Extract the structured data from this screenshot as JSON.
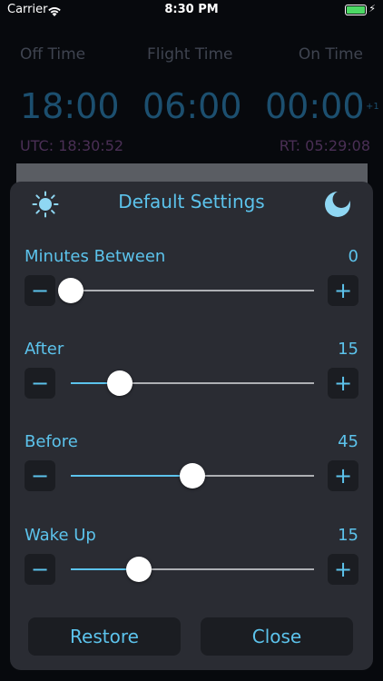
{
  "status_bar": {
    "carrier": "Carrier",
    "time": "8:30 PM"
  },
  "background": {
    "labels": [
      "Off Time",
      "Flight Time",
      "On Time"
    ],
    "times": [
      "18:00",
      "06:00",
      "00:00"
    ],
    "plus_one": "+1",
    "utc": "UTC: 18:30:52",
    "rt": "RT: 05:29:08"
  },
  "modal": {
    "title": "Default Settings",
    "icons": {
      "left": "sun-icon",
      "right": "moon-icon"
    },
    "accent_color": "#5cc3ec",
    "rows": [
      {
        "label": "Minutes Between",
        "value": "0",
        "level": 0.0
      },
      {
        "label": "After",
        "value": "15",
        "level": 0.2
      },
      {
        "label": "Before",
        "value": "45",
        "level": 0.5
      },
      {
        "label": "Wake Up",
        "value": "15",
        "level": 0.28
      }
    ],
    "minus_symbol": "−",
    "plus_symbol": "+",
    "restore_label": "Restore",
    "close_label": "Close"
  }
}
